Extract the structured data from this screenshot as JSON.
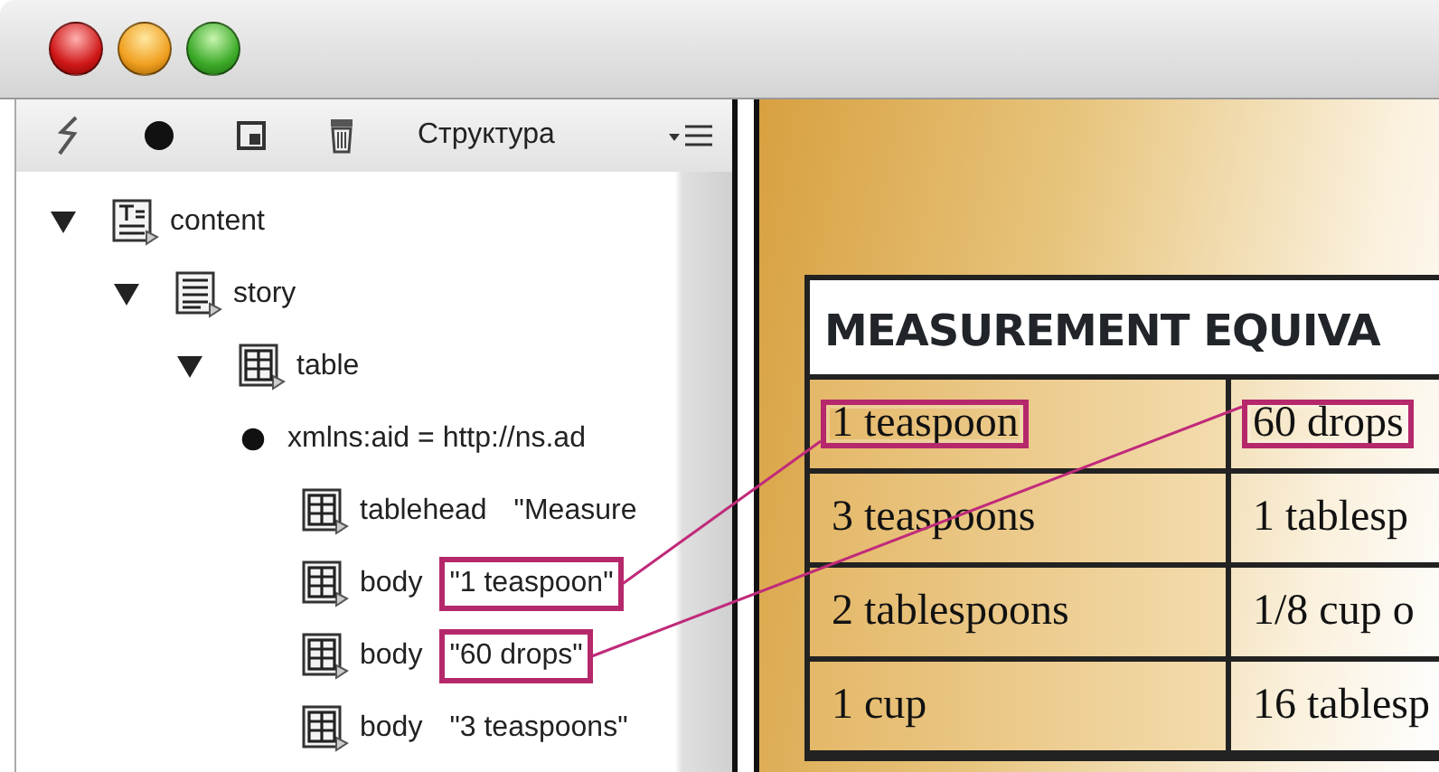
{
  "window": {
    "title_bar": {
      "buttons": [
        {
          "kind": "close"
        },
        {
          "kind": "minimize"
        },
        {
          "kind": "zoom"
        }
      ]
    }
  },
  "structure_panel": {
    "title": "Структура",
    "tree": [
      {
        "kind": "text",
        "label": "content",
        "expanded": true,
        "children": [
          {
            "kind": "story",
            "label": "story",
            "expanded": true,
            "children": [
              {
                "kind": "table",
                "label": "table",
                "expanded": true,
                "children": [
                  {
                    "kind": "attribute",
                    "label": "xmlns:aid = http://ns.ad"
                  },
                  {
                    "kind": "table",
                    "label": "tablehead",
                    "value": "\"Measure",
                    "highlighted": false
                  },
                  {
                    "kind": "table",
                    "label": "body",
                    "value": "\"1 teaspoon\"",
                    "highlighted": true
                  },
                  {
                    "kind": "table",
                    "label": "body",
                    "value": "\"60 drops\"",
                    "highlighted": true
                  },
                  {
                    "kind": "table",
                    "label": "body",
                    "value": "\"3 teaspoons\"",
                    "highlighted": false
                  }
                ]
              }
            ]
          }
        ]
      }
    ]
  },
  "document": {
    "table": {
      "heading": "MEASUREMENT EQUIVA",
      "rows": [
        [
          {
            "text": "1 teaspoon",
            "highlighted": true
          },
          {
            "text": "60 drops",
            "highlighted": true
          }
        ],
        [
          {
            "text": "3 teaspoons",
            "highlighted": false
          },
          {
            "text": "1 tablesp",
            "highlighted": false
          }
        ],
        [
          {
            "text": "2 tablespoons",
            "highlighted": false
          },
          {
            "text": "1/8 cup o",
            "highlighted": false
          }
        ],
        [
          {
            "text": "1 cup",
            "highlighted": false
          },
          {
            "text": "16 tablesp",
            "highlighted": false
          }
        ]
      ]
    }
  }
}
